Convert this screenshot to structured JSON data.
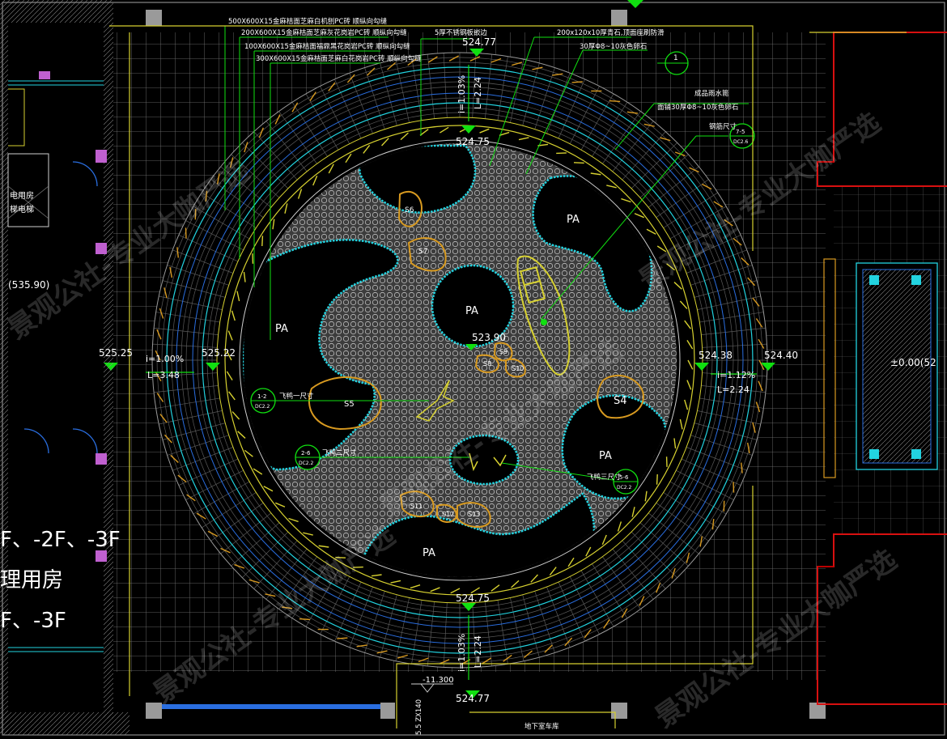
{
  "elevations": {
    "top_outer": "524.77",
    "top_inner": "524.75",
    "left_outer": "525.25",
    "left_inner": "525.22",
    "center": "523.90",
    "right_inner": "524.38",
    "right_outer": "524.40",
    "bottom_inner": "524.75",
    "bottom_outer": "524.77",
    "left_far": "(535.90)",
    "right_far": "±0.00(52",
    "basement": "-11.300"
  },
  "slopes": {
    "top": {
      "i": "i=1.03%",
      "L": "L=2.24"
    },
    "left": {
      "i": "i=1.00%",
      "L": "L=3.48"
    },
    "right": {
      "i": "i=1.12%",
      "L": "L=2.24"
    },
    "bottom": {
      "i": "i=1.03%",
      "L": "L=2.24"
    }
  },
  "material_notes": [
    "500X600X15金麻桔面芝麻白机刨PC砖  顺纵向勾缝",
    "200X600X15金麻桔面芝麻灰花岗岩PC砖  顺纵向勾缝",
    "100X600X15金麻桔面福鼎黑花岗岩PC砖  顺纵向勾缝",
    "300X600X15金麻桔面芝麻白花岗岩PC砖  顺纵向勾缝",
    "5厚不锈钢板嵌边",
    "200x120x10厚青石,顶面座刷防滑",
    "30厚Φ8~10灰色卵石",
    "成品雨水篦",
    "面铺30厚Φ8~10灰色卵石",
    "钢筋尺寸"
  ],
  "planting_labels": [
    "PA",
    "PA",
    "PA",
    "PA",
    "PA"
  ],
  "stone_labels": [
    "S6",
    "S7",
    "S5",
    "S4",
    "S8",
    "S9",
    "S10",
    "S11",
    "S12",
    "S13"
  ],
  "callouts": [
    {
      "num": "1-2",
      "ref": "DC2.2",
      "text": "飞鸭一尺寸"
    },
    {
      "num": "2-6",
      "ref": "DC2.2",
      "text": "飞鸭二尺寸"
    },
    {
      "num": "5-6",
      "ref": "DC2.2",
      "text": "飞鸭三尺寸"
    },
    {
      "num": "7-5",
      "ref": "DC2.6",
      "text": ""
    }
  ],
  "index_mark": "1",
  "left_building": {
    "room_label": "电用房",
    "room_sub": "梯电梯",
    "floors_1": "F、-2F、-3F",
    "rooms_2": "理用房",
    "floors_2": "F、-3F"
  },
  "bottom_labels": {
    "stair_label": "地下室车库",
    "stair_dim": "5.5 ZX140"
  },
  "watermark": "景观公社-专业大咖严选",
  "colors": {
    "cyan": "#22d3e0",
    "green": "#10e010",
    "yellow": "#d6d030",
    "orange": "#d89a20",
    "grid": "#8a8a8a",
    "red": "#d81010",
    "blue": "#2a6ee0",
    "magenta": "#c060d0"
  }
}
